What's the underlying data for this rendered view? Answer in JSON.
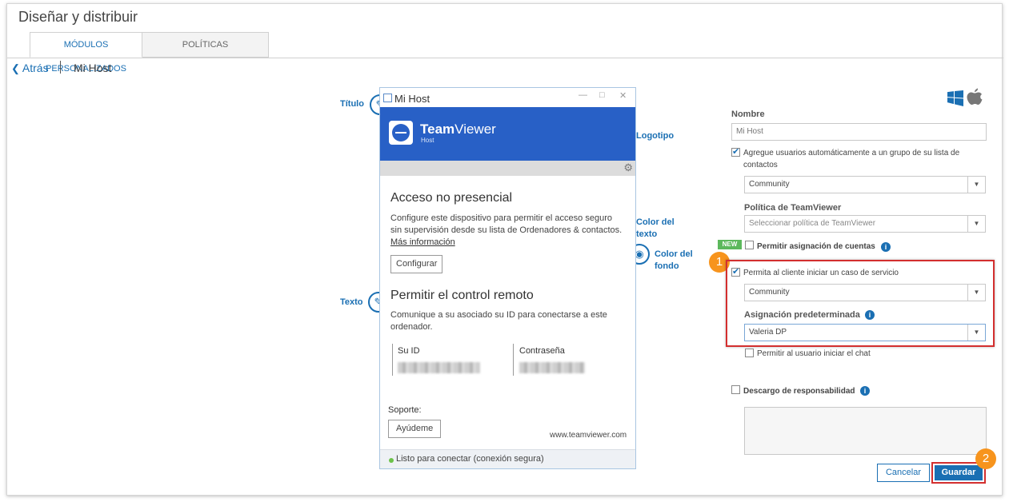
{
  "page": {
    "title": "Diseñar y distribuir"
  },
  "tabs": [
    {
      "label": "MÓDULOS PERSONALIZADOS",
      "active": true
    },
    {
      "label": "POLÍTICAS",
      "active": false
    }
  ],
  "breadcrumb": {
    "back": "Atrás",
    "current": "Mi Host"
  },
  "preview": {
    "window_title": "Mi Host",
    "brand_name_bold": "Team",
    "brand_name_rest": "Viewer",
    "brand_sub": "Host",
    "unattended": {
      "heading": "Acceso no presencial",
      "line1": "Configure este dispositivo para permitir el acceso seguro",
      "line2": "sin supervisión desde su lista de Ordenadores & contactos.",
      "more_link": "Más información",
      "configure_button": "Configurar"
    },
    "remote": {
      "heading": "Permitir el control remoto",
      "line1": "Comunique a su asociado su ID para conectarse a este",
      "line2": "ordenador.",
      "id_label": "Su ID",
      "password_label": "Contraseña"
    },
    "support_label": "Soporte:",
    "help_button": "Ayúdeme",
    "website": "www.teamviewer.com",
    "status": "Listo para conectar (conexión segura)"
  },
  "annotations": {
    "title": "Título",
    "logo": "Logotipo",
    "text_color_1": "Color del",
    "text_color_2": "texto",
    "bg_color_1": "Color del",
    "bg_color_2": "fondo",
    "text": "Texto"
  },
  "form": {
    "name_label": "Nombre",
    "name_placeholder": "Mi Host",
    "auto_add_1": "Agregue usuarios automáticamente a un grupo de su lista de",
    "auto_add_2": "contactos",
    "group_select": "Community",
    "policy_label": "Política de TeamViewer",
    "policy_select": "Seleccionar política de TeamViewer",
    "new_badge": "NEW",
    "allow_account": "Permitir asignación de cuentas",
    "allow_service": "Permita al cliente iniciar un caso de servicio",
    "service_group": "Community",
    "default_assign_label": "Asignación predeterminada",
    "default_assign_value": "Valeria DP",
    "allow_chat": "Permitir al usuario iniciar el chat",
    "disclaimer": "Descargo de responsabilidad",
    "cancel": "Cancelar",
    "save": "Guardar"
  },
  "steps": [
    "1",
    "2"
  ],
  "icons": [
    "pencil-icon",
    "monitor-icon",
    "brush-icon",
    "paint-bucket-icon",
    "gear-icon",
    "windows-icon",
    "apple-icon",
    "info-icon",
    "chevron-left-icon",
    "chevron-down-icon"
  ],
  "colors": {
    "accent": "#1a6fb3",
    "banner": "#2860c6",
    "highlight": "#d32f2f",
    "step": "#f7941d",
    "new": "#5cb85c"
  }
}
